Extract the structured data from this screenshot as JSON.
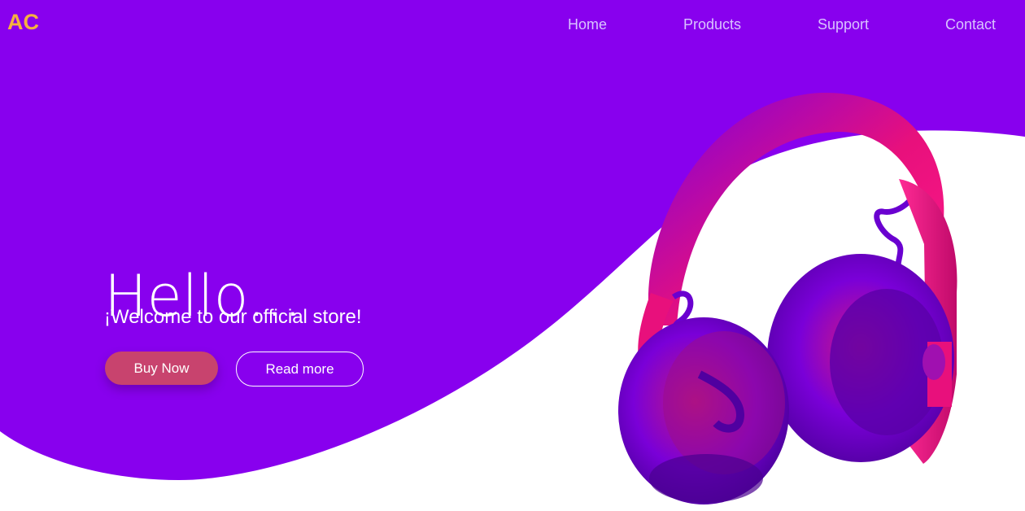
{
  "brand": {
    "logo_text": "AC",
    "logo_color": "#f5b13f"
  },
  "nav": {
    "items": [
      {
        "label": "Home"
      },
      {
        "label": "Products"
      },
      {
        "label": "Support"
      },
      {
        "label": "Contact"
      }
    ]
  },
  "hero": {
    "title": "Hello...",
    "subtitle": "¡Welcome to our official store!",
    "primary_button": "Buy Now",
    "secondary_button": "Read more",
    "product_image": "headphones-image"
  },
  "colors": {
    "hero_background": "#8800ee",
    "page_background": "#ffffff",
    "primary_button": "#c8436e",
    "headphones_pink": "#e8107c",
    "headphones_purple": "#7a00e0"
  }
}
